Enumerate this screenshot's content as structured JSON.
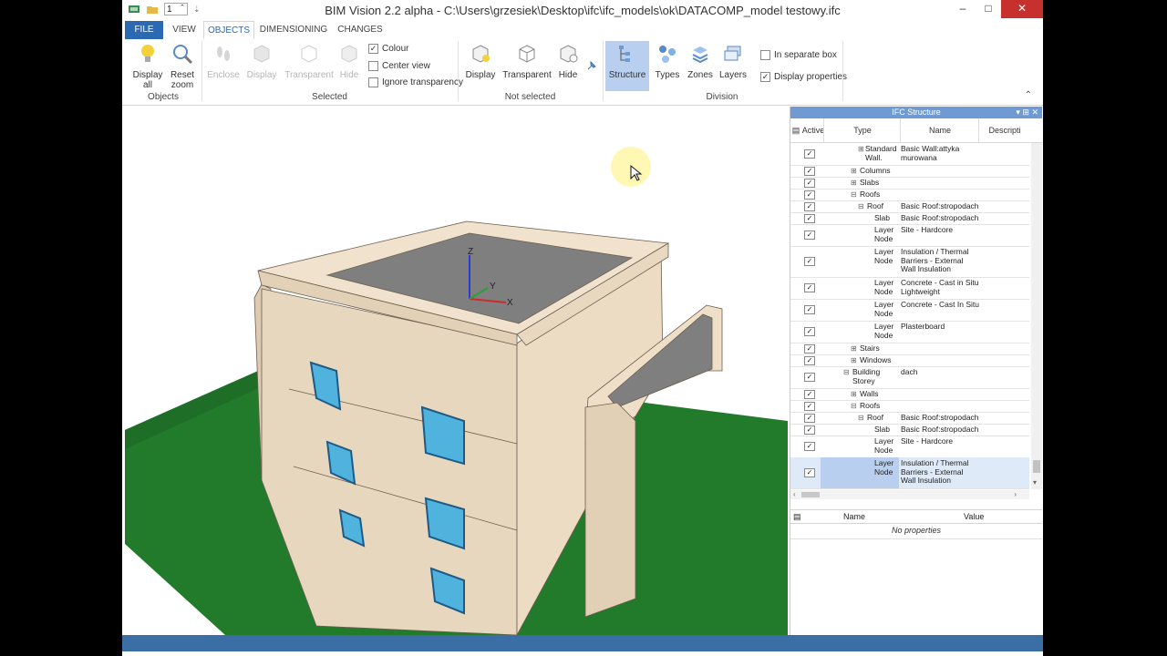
{
  "window": {
    "title": "BIM Vision 2.2 alpha - C:\\Users\\grzesiek\\Desktop\\ifc\\ifc_models\\ok\\DATACOMP_model testowy.ifc",
    "qat_value": "1",
    "minimize": "–",
    "maximize": "□",
    "close": "✕"
  },
  "tabs": [
    "FILE",
    "VIEW",
    "OBJECTS",
    "DIMENSIONING",
    "CHANGES"
  ],
  "ribbon": {
    "display_all": "Display all",
    "reset_zoom": "Reset zoom",
    "group_objects": "Objects",
    "enclose": "Enclose",
    "sel_display": "Display",
    "sel_transparent": "Transparent",
    "sel_hide": "Hide",
    "colour": "Colour",
    "center_view": "Center view",
    "ignore_transparency": "Ignore transparency",
    "group_selected": "Selected",
    "ns_display": "Display",
    "ns_transparent": "Transparent",
    "ns_hide": "Hide",
    "group_not_selected": "Not selected",
    "structure": "Structure",
    "types": "Types",
    "zones": "Zones",
    "layers": "Layers",
    "in_separate_box": "In separate box",
    "display_properties": "Display properties",
    "group_division": "Division",
    "accent": "#2b6ab3"
  },
  "axes": {
    "x": "X",
    "y": "Y",
    "z": "Z"
  },
  "ifc_panel": {
    "title": "IFC Structure",
    "col_active": "Active",
    "col_type": "Type",
    "col_name": "Name",
    "col_description": "Descripti",
    "rows": [
      {
        "type": "Standard Wall.",
        "name": "Basic Wall:attyka murowana"
      },
      {
        "type": "Columns",
        "name": ""
      },
      {
        "type": "Slabs",
        "name": ""
      },
      {
        "type": "Roofs",
        "name": ""
      },
      {
        "type": "Roof",
        "name": "Basic Roof:stropodach"
      },
      {
        "type": "Slab",
        "name": "Basic Roof:stropodach"
      },
      {
        "type": "Layer Node",
        "name": "Site - Hardcore"
      },
      {
        "type": "Layer Node",
        "name": "Insulation / Thermal Barriers - External Wall Insulation"
      },
      {
        "type": "Layer Node",
        "name": "Concrete - Cast in Situ Lightweight"
      },
      {
        "type": "Layer Node",
        "name": "Concrete - Cast In Situ"
      },
      {
        "type": "Layer Node",
        "name": "Plasterboard"
      },
      {
        "type": "Stairs",
        "name": ""
      },
      {
        "type": "Windows",
        "name": ""
      },
      {
        "type": "Building Storey",
        "name": "dach"
      },
      {
        "type": "Walls",
        "name": ""
      },
      {
        "type": "Roofs",
        "name": ""
      },
      {
        "type": "Roof",
        "name": "Basic Roof:stropodach"
      },
      {
        "type": "Slab",
        "name": "Basic Roof:stropodach"
      },
      {
        "type": "Layer Node",
        "name": "Site - Hardcore"
      },
      {
        "type": "Layer Node",
        "name": "Insulation / Thermal Barriers - External Wall Insulation"
      }
    ]
  },
  "properties": {
    "col_name": "Name",
    "col_value": "Value",
    "empty": "No properties"
  }
}
